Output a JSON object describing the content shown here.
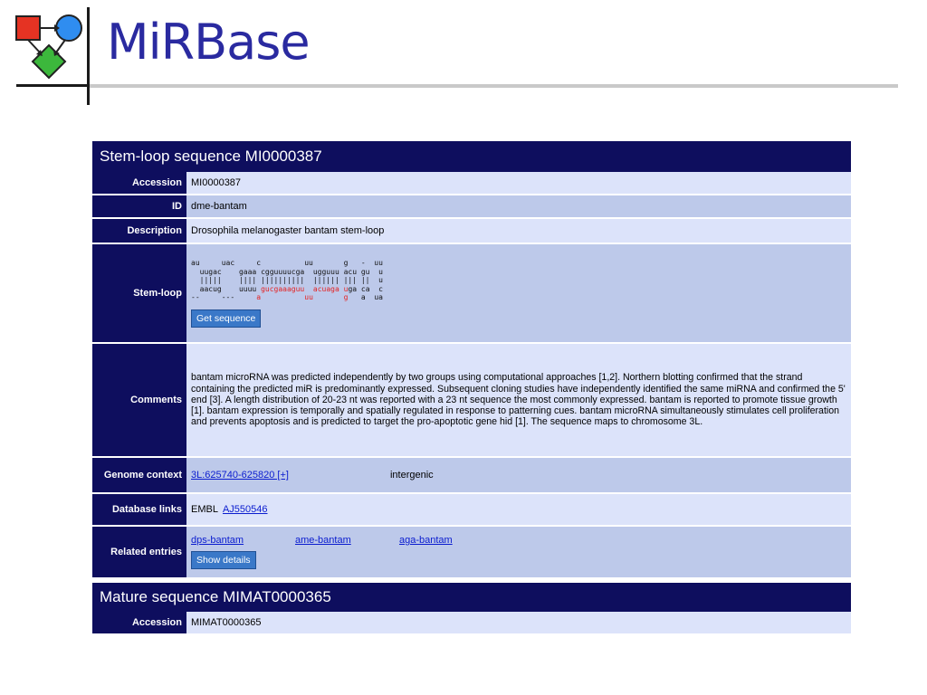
{
  "slide": {
    "title": "MiRBase"
  },
  "colors": {
    "title": "#2a2aa0",
    "section_header": "#0e0e5e",
    "row_light": "#dce3fa",
    "row_dark": "#bdc9ea",
    "link": "#0a1ccf",
    "button": "#3a78c8",
    "highlight": "#e52222",
    "logo_square": "#e53323",
    "logo_circle": "#2f8df0",
    "logo_diamond": "#3cb83c"
  },
  "icons": {
    "logo": "flowchart-logo-icon"
  },
  "stemloop_section": {
    "header": "Stem-loop sequence MI0000387",
    "accession": {
      "label": "Accession",
      "value": "MI0000387"
    },
    "id": {
      "label": "ID",
      "value": "dme-bantam"
    },
    "description": {
      "label": "Description",
      "value": "Drosophila melanogaster bantam stem-loop"
    },
    "stemloop": {
      "label": "Stem-loop",
      "line1": "au     uac     c          uu       g   -  uu",
      "line2": "  uugac    gaaa cgguuuucga  ugguuu acu gu  u",
      "line3": "  |||||    |||| ||||||||||  |||||| ||| ||  u",
      "line4_pre": "  aacug    uuuu ",
      "line4_red1": "gucgaaaguu",
      "line4_mid": "  ",
      "line4_red2": "acuaga",
      "line4_mid2": " ",
      "line4_red3": "u",
      "line4_post": "ga ca  c",
      "line5_pre": "--     ---     ",
      "line5_red1": "a",
      "line5_mid": "          ",
      "line5_red2": "uu",
      "line5_mid2": "       ",
      "line5_red3": "g",
      "line5_post": "   a  ua",
      "button": "Get sequence"
    },
    "comments": {
      "label": "Comments",
      "text": "bantam microRNA was predicted independently by two groups using computational approaches [1,2]. Northern blotting confirmed that the strand containing the predicted miR is predominantly expressed. Subsequent cloning studies have independently identified the same miRNA and confirmed the 5' end [3]. A length distribution of 20-23 nt was reported with a 23 nt sequence the most commonly expressed. bantam is reported to promote tissue growth [1]. bantam expression is temporally and spatially regulated in response to patterning cues. bantam microRNA simultaneously stimulates cell proliferation and prevents apoptosis and is predicted to target the pro-apoptotic gene hid [1]. The sequence maps to chromosome 3L."
    },
    "genome_context": {
      "label": "Genome context",
      "link": "3L:625740-625820 [+]",
      "type": "intergenic"
    },
    "database_links": {
      "label": "Database links",
      "db": "EMBL",
      "link": "AJ550546"
    },
    "related_entries": {
      "label": "Related entries",
      "entries": [
        "dps-bantam",
        "ame-bantam",
        "aga-bantam"
      ],
      "button": "Show details"
    }
  },
  "mature_section": {
    "header": "Mature sequence MIMAT0000365",
    "accession": {
      "label": "Accession",
      "value": "MIMAT0000365"
    }
  }
}
